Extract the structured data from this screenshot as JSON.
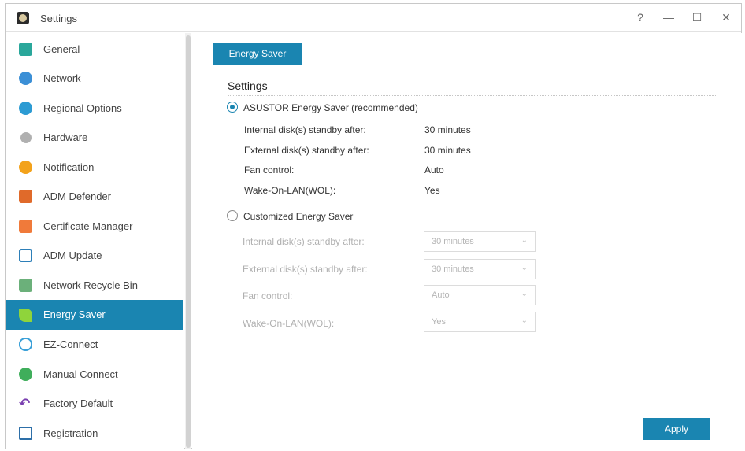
{
  "window": {
    "title": "Settings",
    "help_glyph": "?",
    "minimize_glyph": "—",
    "maximize_glyph": "☐",
    "close_glyph": "✕"
  },
  "sidebar": {
    "items": [
      {
        "label": "General",
        "icon": "general-icon",
        "color": "#2aa79b"
      },
      {
        "label": "Network",
        "icon": "globe-icon",
        "color": "#3b8fd6"
      },
      {
        "label": "Regional Options",
        "icon": "regional-icon",
        "color": "#2c9bd3"
      },
      {
        "label": "Hardware",
        "icon": "wrench-icon",
        "color": "#9a9a9a"
      },
      {
        "label": "Notification",
        "icon": "alert-icon",
        "color": "#f3a21b"
      },
      {
        "label": "ADM Defender",
        "icon": "defender-icon",
        "color": "#e06a2a"
      },
      {
        "label": "Certificate Manager",
        "icon": "certificate-icon",
        "color": "#f07a3a"
      },
      {
        "label": "ADM Update",
        "icon": "update-icon",
        "color": "#2d7fb8"
      },
      {
        "label": "Network Recycle Bin",
        "icon": "recycle-bin-icon",
        "color": "#6bb07a"
      },
      {
        "label": "Energy Saver",
        "icon": "leaf-icon",
        "color": "#8fd43b"
      },
      {
        "label": "EZ-Connect",
        "icon": "cloud-icon",
        "color": "#3aa0d8"
      },
      {
        "label": "Manual Connect",
        "icon": "connect-icon",
        "color": "#3fae5b"
      },
      {
        "label": "Factory Default",
        "icon": "undo-icon",
        "color": "#7a3fb0"
      },
      {
        "label": "Registration",
        "icon": "registration-icon",
        "color": "#2d6fa8"
      }
    ],
    "active_index": 9
  },
  "main": {
    "tab_label": "Energy Saver",
    "section_title": "Settings",
    "option_asustor": {
      "label": "ASUSTOR Energy Saver (recommended)",
      "selected": true,
      "rows": [
        {
          "label": "Internal disk(s) standby after:",
          "value": "30 minutes"
        },
        {
          "label": "External disk(s) standby after:",
          "value": "30 minutes"
        },
        {
          "label": "Fan control:",
          "value": "Auto"
        },
        {
          "label": "Wake-On-LAN(WOL):",
          "value": "Yes"
        }
      ]
    },
    "option_custom": {
      "label": "Customized Energy Saver",
      "selected": false,
      "rows": [
        {
          "label": "Internal disk(s) standby after:",
          "value": "30 minutes"
        },
        {
          "label": "External disk(s) standby after:",
          "value": "30 minutes"
        },
        {
          "label": "Fan control:",
          "value": "Auto"
        },
        {
          "label": "Wake-On-LAN(WOL):",
          "value": "Yes"
        }
      ]
    },
    "apply_label": "Apply",
    "accent_color": "#1a85b1"
  }
}
